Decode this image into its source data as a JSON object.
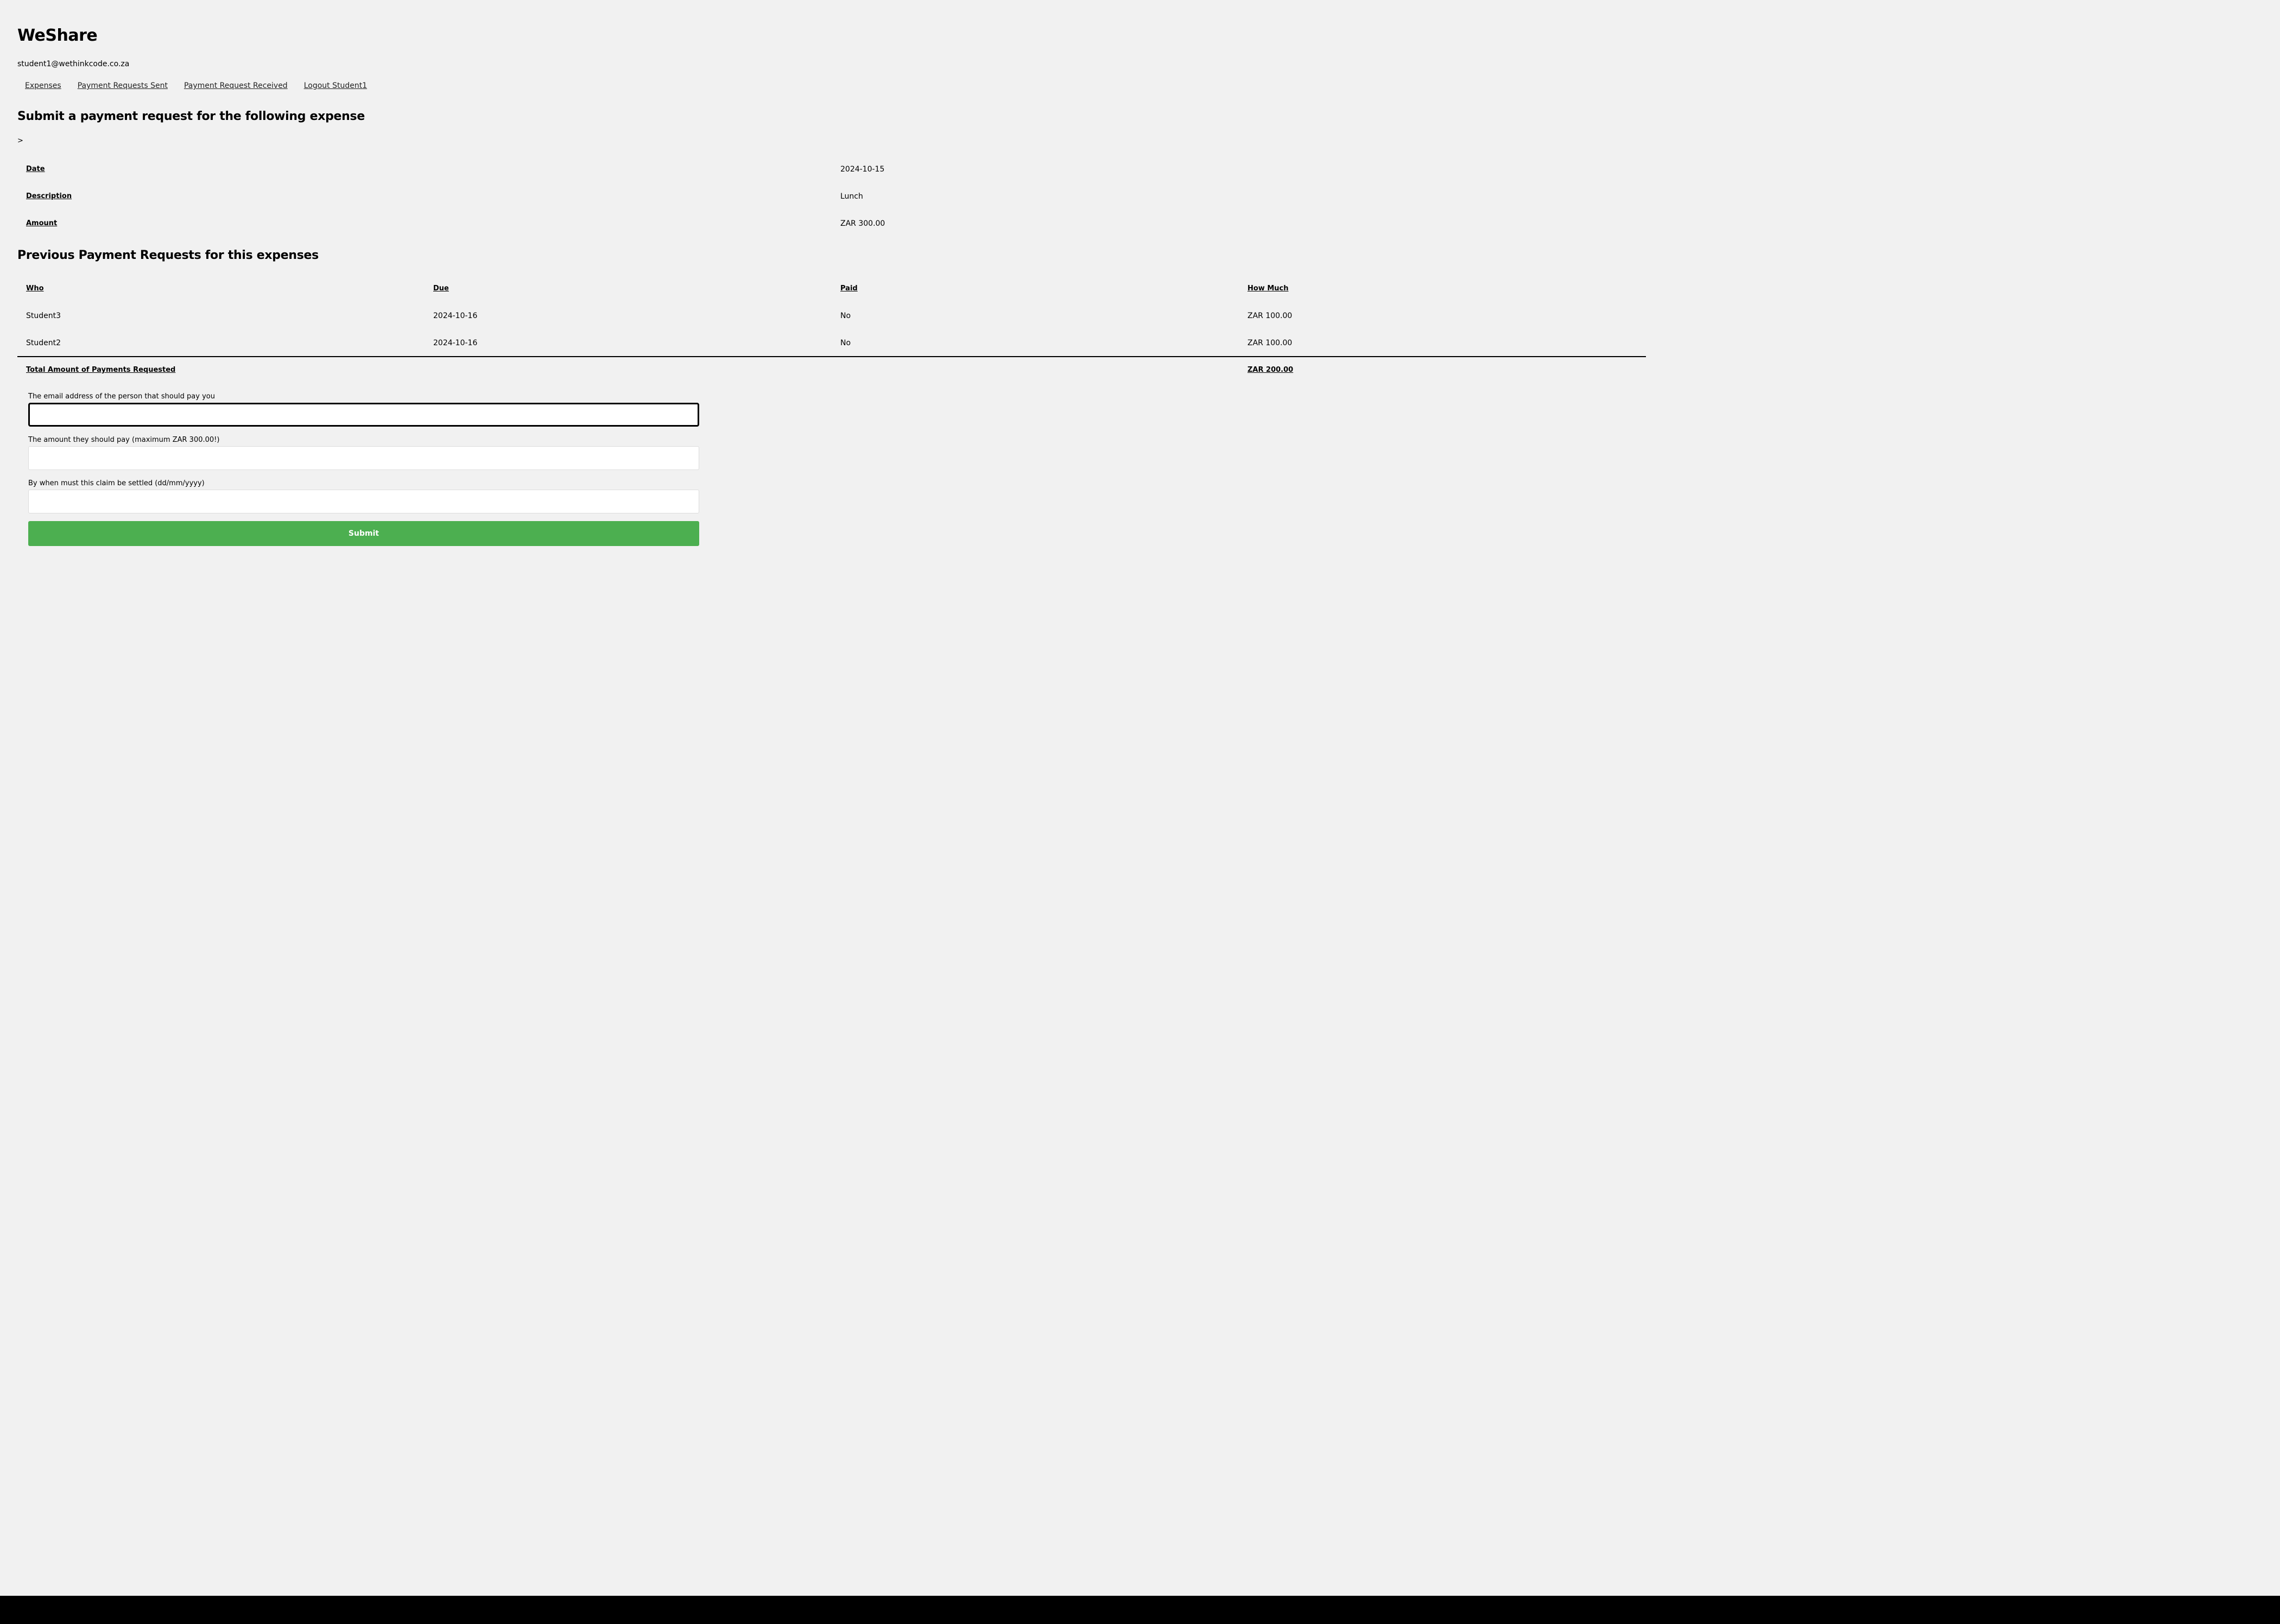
{
  "app": {
    "title": "WeShare",
    "user_email": "student1@wethinkcode.co.za"
  },
  "nav": {
    "items": [
      {
        "label": "Expenses"
      },
      {
        "label": "Payment Requests Sent"
      },
      {
        "label": "Payment Request Received"
      },
      {
        "label": "Logout Student1"
      }
    ]
  },
  "expense_section": {
    "heading": "Submit a payment request for the following expense",
    "stray_text": ">",
    "rows": [
      {
        "label": "Date",
        "value": "2024-10-15"
      },
      {
        "label": "Description",
        "value": "Lunch"
      },
      {
        "label": "Amount",
        "value": "ZAR 300.00"
      }
    ]
  },
  "previous_requests": {
    "heading": "Previous Payment Requests for this expenses",
    "columns": [
      "Who",
      "Due",
      "Paid",
      "How Much"
    ],
    "rows": [
      {
        "who": "Student3",
        "due": "2024-10-16",
        "paid": "No",
        "amount": "ZAR 100.00"
      },
      {
        "who": "Student2",
        "due": "2024-10-16",
        "paid": "No",
        "amount": "ZAR 100.00"
      }
    ],
    "total_label": "Total Amount of Payments Requested",
    "total_value": "ZAR 200.00"
  },
  "form": {
    "email_label": "The email address of the person that should pay you",
    "email_value": "",
    "amount_label": "The amount they should pay (maximum ZAR 300.00!)",
    "amount_value": "",
    "date_label": "By when must this claim be settled (dd/mm/yyyy)",
    "date_value": "",
    "submit_label": "Submit",
    "submit_color": "#4caf50"
  }
}
